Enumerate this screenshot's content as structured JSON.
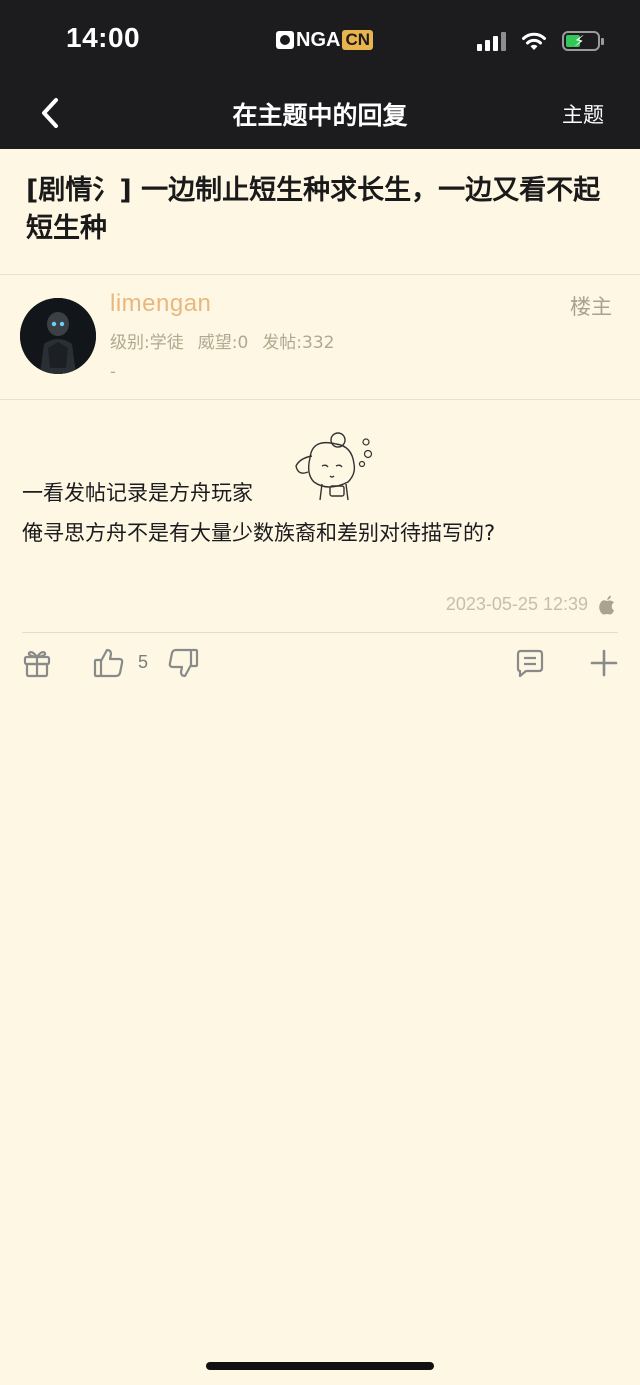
{
  "status_bar": {
    "time": "14:00",
    "logo_text": "NGA",
    "logo_suffix": "CN"
  },
  "nav": {
    "back_icon": "chevron-left-icon",
    "title": "在主题中的回复",
    "right_label": "主题"
  },
  "thread": {
    "title": "[剧情氵] 一边制止短生种求长生，一边又看不起短生种"
  },
  "author": {
    "name": "limengan",
    "level": "级别:学徒",
    "prestige": "威望:0",
    "posts": "发帖:332",
    "signature": "-",
    "floor_tag": "楼主"
  },
  "post": {
    "lines": [
      "一看发帖记录是方舟玩家",
      "俺寻思方舟不是有大量少数族裔和差别对待描写的?"
    ],
    "timestamp": "2023-05-25 12:39",
    "device_icon": "apple-icon"
  },
  "actions": {
    "gift_icon": "gift-icon",
    "like_icon": "thumbs-up-icon",
    "like_count": "5",
    "dislike_icon": "thumbs-down-icon",
    "comment_icon": "comment-icon",
    "more_icon": "plus-icon"
  },
  "colors": {
    "background": "#fdf7e4",
    "header": "#1c1c1e",
    "author_name": "#e9b77d",
    "battery": "#34c759"
  }
}
